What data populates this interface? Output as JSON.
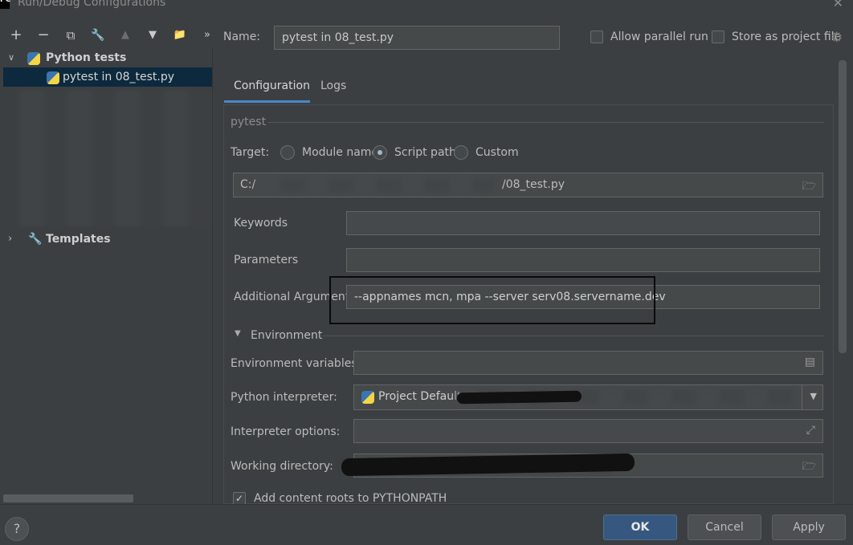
{
  "window": {
    "title": "Run/Debug Configurations",
    "app_icon": "PC"
  },
  "toolbar": {
    "add": "+",
    "remove": "−",
    "copy": "⧉",
    "edit": "🔧",
    "up": "▲",
    "down": "▼",
    "folder": "📁",
    "more": "»"
  },
  "tree": {
    "group_label": "Python tests",
    "item_label": "pytest in 08_test.py",
    "templates_label": "Templates"
  },
  "header": {
    "name_label": "Name:",
    "name_value": "pytest in 08_test.py",
    "parallel_label": "Allow parallel run",
    "store_label": "Store as project file"
  },
  "tabs": [
    {
      "label": "Configuration"
    },
    {
      "label": "Logs"
    }
  ],
  "config": {
    "section_label": "pytest",
    "target_label": "Target:",
    "target_options": [
      "Module name",
      "Script path",
      "Custom"
    ],
    "script_prefix": "C:/",
    "script_suffix": "/08_test.py",
    "keywords_label": "Keywords",
    "parameters_label": "Parameters",
    "additional_args_label": "Additional Arguments",
    "additional_args_value": "--appnames mcn, mpa --server serv08.servername.dev",
    "environment_label": "Environment",
    "env_vars_label": "Environment variables:",
    "interpreter_label": "Python interpreter:",
    "interpreter_value": "Project Default",
    "interp_options_label": "Interpreter options:",
    "working_dir_label": "Working directory:",
    "content_roots_label": "Add content roots to PYTHONPATH"
  },
  "footer": {
    "help": "?",
    "ok": "OK",
    "cancel": "Cancel",
    "apply": "Apply"
  }
}
